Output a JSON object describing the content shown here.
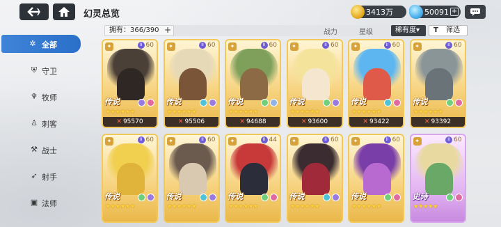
{
  "header": {
    "title": "幻灵总览",
    "gold": "3413万",
    "gems": "50091",
    "plus": "+"
  },
  "filter": {
    "owned": "拥有：366/390",
    "owned_plus": "+",
    "tabs": [
      "战力",
      "星级"
    ],
    "sort": "稀有度▾",
    "filter_icon": "T",
    "filter_label": "筛选"
  },
  "sidebar": {
    "items": [
      {
        "icon": "✲",
        "label": "全部"
      },
      {
        "icon": "⛨",
        "label": "守卫"
      },
      {
        "icon": "♆",
        "label": "牧师"
      },
      {
        "icon": "♙",
        "label": "刺客"
      },
      {
        "icon": "⚒",
        "label": "战士"
      },
      {
        "icon": "➶",
        "label": "射手"
      },
      {
        "icon": "▣",
        "label": "法师"
      }
    ]
  },
  "cards": [
    {
      "rank": "传说",
      "stars": "★★★★★★",
      "power": "95570",
      "level": "60",
      "art": "#4b4038",
      "art2": "#2e2723",
      "elem1": "#9a7ae0",
      "elem2": "#e06aa0",
      "epic": false
    },
    {
      "rank": "传说",
      "stars": "★★★★★★",
      "power": "95506",
      "level": "60",
      "art": "#e6d9b8",
      "art2": "#7a5538",
      "elem1": "#4fc3d6",
      "elem2": "#9a7ae0",
      "epic": false
    },
    {
      "rank": "传说",
      "stars": "★★★★★★",
      "power": "94688",
      "level": "60",
      "art": "#7fa05a",
      "art2": "#8b6a45",
      "elem1": "#6fcf7a",
      "elem2": "#8fb3e6",
      "epic": false
    },
    {
      "rank": "传说",
      "stars": "★★★★★★",
      "power": "93600",
      "level": "60",
      "art": "#f4e39a",
      "art2": "#f5e7cf",
      "elem1": "#6fcf7a",
      "elem2": "#9a7ae0",
      "epic": false
    },
    {
      "rank": "传说",
      "stars": "★★★★★★",
      "power": "93422",
      "level": "60",
      "art": "#5db6f0",
      "art2": "#e05a4a",
      "elem1": "#4fc3d6",
      "elem2": "#e06aa0",
      "epic": false
    },
    {
      "rank": "传说",
      "stars": "★★★★★★",
      "power": "93392",
      "level": "60",
      "art": "#8a9598",
      "art2": "#6a7478",
      "elem1": "#6fcf7a",
      "elem2": "#e06aa0",
      "epic": false
    },
    {
      "rank": "传说",
      "stars": "★★★★★★",
      "power": "",
      "level": "60",
      "art": "#f1cf4f",
      "art2": "#e0b43a",
      "elem1": "#6fcf7a",
      "elem2": "#9a7ae0",
      "epic": false
    },
    {
      "rank": "传说",
      "stars": "★★★★★★",
      "power": "",
      "level": "60",
      "art": "#6b5a4e",
      "art2": "#d8c9b0",
      "elem1": "#4fc3d6",
      "elem2": "#9a7ae0",
      "epic": false
    },
    {
      "rank": "传说",
      "stars": "★★★★★★",
      "power": "",
      "level": "44",
      "art": "#c83a3a",
      "art2": "#2b2d3a",
      "elem1": "#6fcf7a",
      "elem2": "#e06aa0",
      "epic": false
    },
    {
      "rank": "传说",
      "stars": "★★★★★★",
      "power": "",
      "level": "60",
      "art": "#3a2c30",
      "art2": "#a02a3a",
      "elem1": "#4fc3d6",
      "elem2": "#9a7ae0",
      "epic": false
    },
    {
      "rank": "传说",
      "stars": "★★★★★★",
      "power": "",
      "level": "60",
      "art": "#7a3ea8",
      "art2": "#b86ad0",
      "elem1": "#6fcf7a",
      "elem2": "#e06aa0",
      "epic": false
    },
    {
      "rank": "史诗",
      "stars": "★★★★★",
      "power": "",
      "level": "60",
      "art": "#e8d9a0",
      "art2": "#6aa868",
      "elem1": "#6fcf7a",
      "elem2": "#e06aa0",
      "epic": true
    }
  ]
}
